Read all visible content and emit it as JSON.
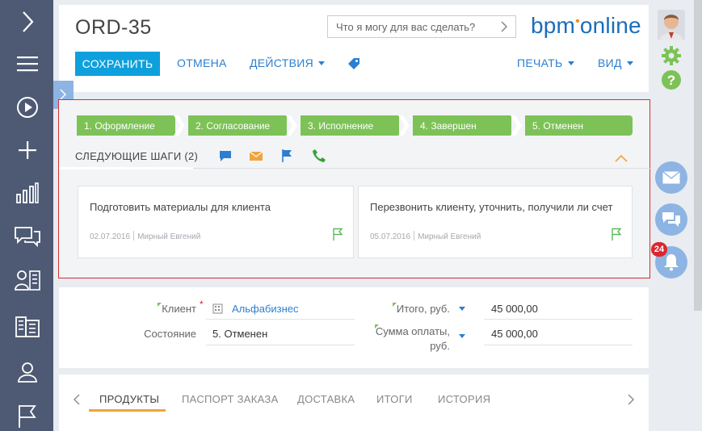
{
  "nav": {
    "items": [
      "expand-icon",
      "menu-icon",
      "play-icon",
      "add-icon",
      "analytics-icon",
      "feed-icon",
      "contacts-icon",
      "accounts-icon",
      "user-icon",
      "flag-icon"
    ]
  },
  "header": {
    "title": "ORD-35",
    "search_placeholder": "Что я могу для вас сделать?",
    "logo": "bpm'online",
    "logo_main": "bpm",
    "logo_tail": "online",
    "save": "СОХРАНИТЬ",
    "cancel": "ОТМЕНА",
    "actions": "ДЕЙСТВИЯ",
    "print": "ПЕЧАТЬ",
    "view": "ВИД"
  },
  "stages": [
    {
      "label": "1. Оформление"
    },
    {
      "label": "2. Согласование"
    },
    {
      "label": "3. Исполнение"
    },
    {
      "label": "4. Завершен"
    },
    {
      "label": "5. Отменен"
    }
  ],
  "next_steps": {
    "title": "СЛЕДУЮЩИЕ ШАГИ (2)",
    "tasks": [
      {
        "title": "Подготовить материалы для клиента",
        "date": "02.07.2016",
        "owner": "Мирный Евгений"
      },
      {
        "title": "Перезвонить клиенту, уточнить, получили ли счет",
        "date": "05.07.2016",
        "owner": "Мирный Евгений"
      }
    ]
  },
  "form": {
    "client_label": "Клиент",
    "client_value": "Альфабизнес",
    "state_label": "Состояние",
    "state_value": "5. Отменен",
    "total_label": "Итого, руб.",
    "total_value": "45 000,00",
    "paid_label_1": "Сумма оплаты,",
    "paid_label_2": "руб.",
    "paid_value": "45 000,00"
  },
  "tabs": [
    "ПРОДУКТЫ",
    "ПАСПОРТ ЗАКАЗА",
    "ДОСТАВКА",
    "ИТОГИ",
    "ИСТОРИЯ"
  ],
  "notifications": {
    "count": "24"
  },
  "colors": {
    "accent": "#0ea0dd",
    "stage": "#7dc257",
    "nav": "#4e5a73",
    "link": "#2c7fd0"
  }
}
